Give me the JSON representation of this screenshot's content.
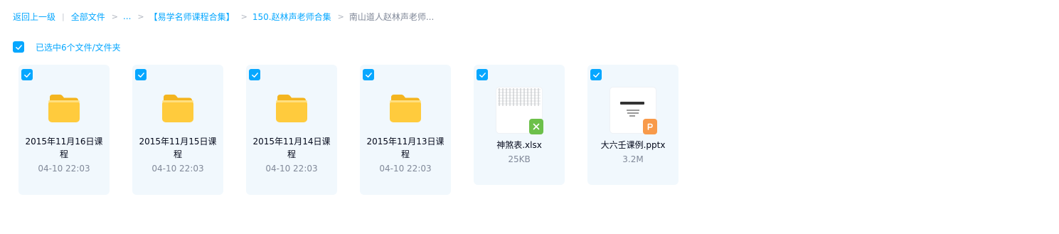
{
  "breadcrumb": {
    "back": "返回上一级",
    "all_files": "全部文件",
    "ellipsis": "...",
    "folder1": "【易学名师课程合集】",
    "folder2": "150.赵林声老师合集",
    "current": "南山道人赵林声老师..."
  },
  "selection": {
    "text": "已选中6个文件/文件夹"
  },
  "items": [
    {
      "name": "2015年11月16日课程",
      "meta": "04-10 22:03",
      "type": "folder"
    },
    {
      "name": "2015年11月15日课程",
      "meta": "04-10 22:03",
      "type": "folder"
    },
    {
      "name": "2015年11月14日课程",
      "meta": "04-10 22:03",
      "type": "folder"
    },
    {
      "name": "2015年11月13日课程",
      "meta": "04-10 22:03",
      "type": "folder"
    },
    {
      "name": "神煞表.xlsx",
      "meta": "25KB",
      "type": "excel"
    },
    {
      "name": "大六壬课例.pptx",
      "meta": "3.2M",
      "type": "powerpoint"
    }
  ],
  "colors": {
    "accent": "#06a7ff",
    "card_bg": "#f1f8fd",
    "folder": "#ffcb3d",
    "excel_badge": "#6cc04a",
    "ppt_badge": "#f89a4a"
  }
}
